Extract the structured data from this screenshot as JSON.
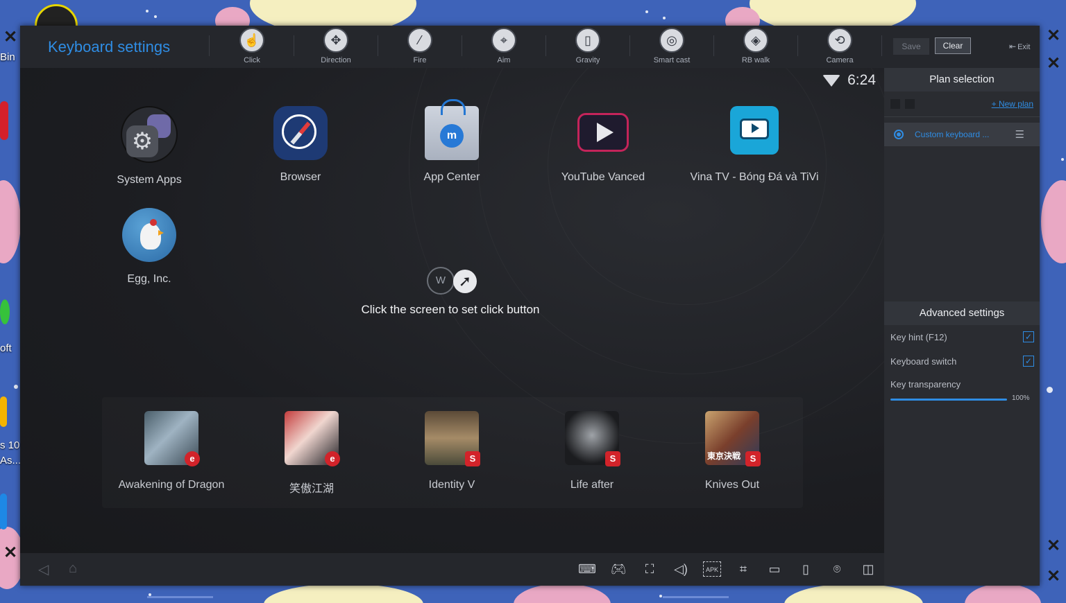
{
  "desktop": {
    "labels": [
      "Bin",
      "oft",
      "s 10",
      "As..."
    ]
  },
  "toolbar": {
    "title": "Keyboard settings",
    "tools": [
      {
        "label": "Click",
        "icon": "hand-pointer-icon"
      },
      {
        "label": "Direction",
        "icon": "dpad-icon"
      },
      {
        "label": "Fire",
        "icon": "bullet-icon"
      },
      {
        "label": "Aim",
        "icon": "crosshair-icon"
      },
      {
        "label": "Gravity",
        "icon": "phone-tilt-icon"
      },
      {
        "label": "Smart cast",
        "icon": "target-ring-icon"
      },
      {
        "label": "RB walk",
        "icon": "mouse-dpad-icon"
      },
      {
        "label": "Camera",
        "icon": "rotate-view-icon"
      }
    ],
    "save_label": "Save",
    "clear_label": "Clear",
    "exit_label": "Exit"
  },
  "screen": {
    "time": "6:24",
    "apps": [
      {
        "label": "System Apps"
      },
      {
        "label": "Browser"
      },
      {
        "label": "App Center"
      },
      {
        "label": "YouTube Vanced"
      },
      {
        "label": "Vina TV - Bóng Đá và TiVi"
      },
      {
        "label": "Egg, Inc."
      }
    ],
    "hint": {
      "key": "W",
      "text": "Click the screen to set click button"
    },
    "dock": [
      {
        "label": "Awakening of Dragon"
      },
      {
        "label": "笑傲江湖"
      },
      {
        "label": "Identity V"
      },
      {
        "label": "Life after"
      },
      {
        "label": "Knives Out"
      }
    ],
    "dock_icon_text": "東京決戦"
  },
  "navbar": {
    "icons": [
      "keyboard-icon",
      "gamepad-icon",
      "screenshot-icon",
      "volume-icon",
      "apk-install-icon",
      "crop-icon",
      "folder-icon",
      "shake-icon",
      "location-icon",
      "rotate-screen-icon"
    ],
    "apk_label": "APK"
  },
  "panel": {
    "plan_title": "Plan selection",
    "new_plan_label": "+ New plan",
    "plan_name": "Custom keyboard ...",
    "advanced_title": "Advanced settings",
    "options": [
      {
        "label": "Key hint (F12)",
        "checked": true
      },
      {
        "label": "Keyboard switch",
        "checked": true
      }
    ],
    "transparency_label": "Key transparency",
    "transparency_value": "100%",
    "transparency_level": 1.0
  },
  "colors": {
    "accent": "#2f8de4",
    "toolbar_bg": "#25272c",
    "panel_bg": "#2a2c31",
    "desktop_bg": "#3e63b9"
  }
}
